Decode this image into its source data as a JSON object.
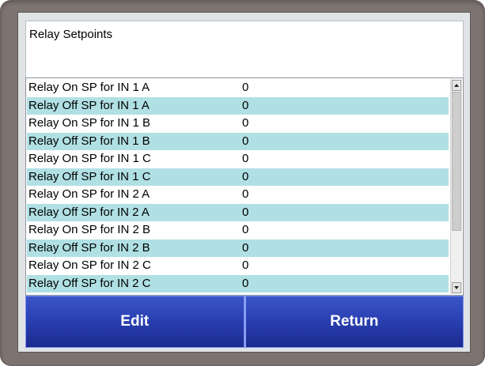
{
  "header": {
    "title": "Relay Setpoints"
  },
  "list": {
    "rows": [
      {
        "name": "Relay On SP for IN 1 A",
        "value": "0"
      },
      {
        "name": "Relay Off SP for IN 1 A",
        "value": "0"
      },
      {
        "name": "Relay On SP for IN 1 B",
        "value": "0"
      },
      {
        "name": "Relay Off SP for IN 1 B",
        "value": "0"
      },
      {
        "name": "Relay On SP for IN 1 C",
        "value": "0"
      },
      {
        "name": "Relay Off SP for IN 1 C",
        "value": "0"
      },
      {
        "name": "Relay On SP for IN 2 A",
        "value": "0"
      },
      {
        "name": "Relay Off SP for IN 2 A",
        "value": "0"
      },
      {
        "name": "Relay On SP for IN 2 B",
        "value": "0"
      },
      {
        "name": "Relay Off SP for IN 2 B",
        "value": "0"
      },
      {
        "name": "Relay On SP for IN 2 C",
        "value": "0"
      },
      {
        "name": "Relay Off SP for IN 2 C",
        "value": "0"
      }
    ],
    "alt_row_color": "#b0e0e4"
  },
  "scrollbar": {
    "up_icon": "triangle-up-icon",
    "down_icon": "triangle-down-icon"
  },
  "buttons": {
    "edit_label": "Edit",
    "return_label": "Return",
    "color": "#2a41b3"
  },
  "colors": {
    "bezel": "#7d7471",
    "screen": "#dfe3e6"
  }
}
